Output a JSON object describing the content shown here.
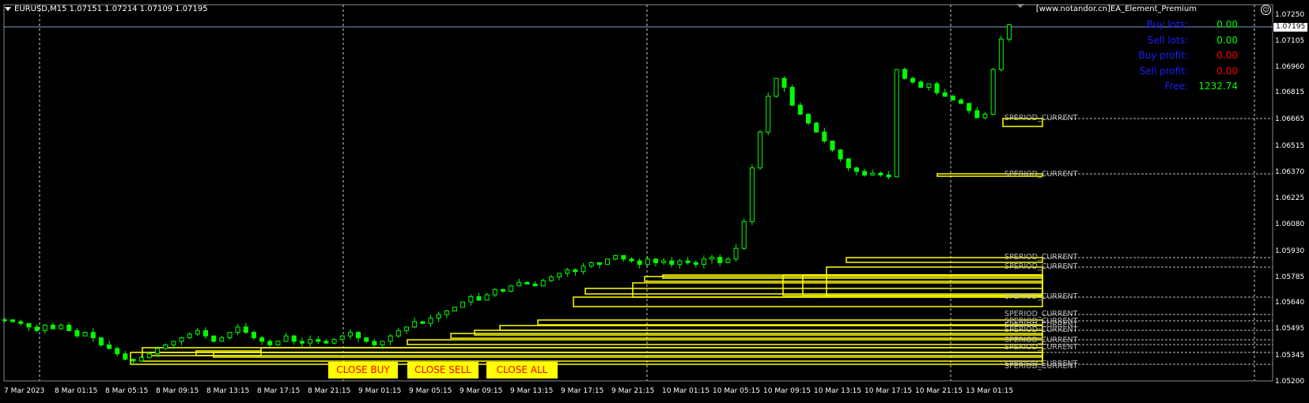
{
  "window": {
    "title": "EURUSD,M15  1.07151 1.07214 1.07109 1.07195",
    "ea_name": "[www.notandor.cn]EA_Element_Premium",
    "smiley": "☺"
  },
  "colors": {
    "background": "#000000",
    "candle": "#00ff00",
    "rectangle": "#ffff00",
    "button_bg": "#ffff00",
    "button_text": "#ff0000",
    "label_blue": "#1e1eff",
    "value_green": "#00ff00",
    "value_red": "#ff0000"
  },
  "panel": [
    {
      "label": "Buy lots:",
      "value": "0.00",
      "color": "green"
    },
    {
      "label": "Sell lots:",
      "value": "0.00",
      "color": "green"
    },
    {
      "label": "Buy profit:",
      "value": "0.00",
      "color": "red"
    },
    {
      "label": "Sell profit:",
      "value": "0.00",
      "color": "red"
    },
    {
      "label": "Free:",
      "value": "1232.74",
      "color": "green"
    }
  ],
  "buttons": {
    "close_buy": "CLOSE BUY",
    "close_sell": "CLOSE SELL",
    "close_all": "CLOSE ALL"
  },
  "price_axis": {
    "current_price": "1.07195",
    "labels": [
      "1.07250",
      "1.07105",
      "1.06960",
      "1.06815",
      "1.06665",
      "1.06515",
      "1.06370",
      "1.06225",
      "1.06080",
      "1.05930",
      "1.05785",
      "1.05640",
      "1.05495",
      "1.05345",
      "1.05200"
    ]
  },
  "time_axis": [
    "7 Mar 2023",
    "8 Mar 01:15",
    "8 Mar 05:15",
    "8 Mar 09:15",
    "8 Mar 13:15",
    "8 Mar 17:15",
    "8 Mar 21:15",
    "9 Mar 01:15",
    "9 Mar 05:15",
    "9 Mar 09:15",
    "9 Mar 13:15",
    "9 Mar 17:15",
    "9 Mar 21:15",
    "10 Mar 01:15",
    "10 Mar 05:15",
    "10 Mar 09:15",
    "10 Mar 13:15",
    "10 Mar 17:15",
    "10 Mar 21:15",
    "13 Mar 01:15"
  ],
  "period_label_text": "SPERIOD_CURRENT",
  "chart_data": {
    "type": "candlestick",
    "symbol": "EURUSD",
    "timeframe": "M15",
    "ylim": [
      1.052,
      1.0725
    ],
    "closes": [
      1.0555,
      1.0554,
      1.0553,
      1.0551,
      1.0549,
      1.0552,
      1.055,
      1.0552,
      1.0549,
      1.0546,
      1.0548,
      1.0545,
      1.0541,
      1.0539,
      1.0536,
      1.0533,
      1.0532,
      1.0534,
      1.0536,
      1.0539,
      1.0541,
      1.0543,
      1.0545,
      1.0547,
      1.0549,
      1.0546,
      1.0543,
      1.0545,
      1.0548,
      1.0551,
      1.0548,
      1.0545,
      1.0543,
      1.0541,
      1.0543,
      1.0546,
      1.0543,
      1.0542,
      1.0544,
      1.0543,
      1.0542,
      1.0544,
      1.0546,
      1.0548,
      1.0545,
      1.0543,
      1.0541,
      1.0543,
      1.0546,
      1.0549,
      1.0551,
      1.0554,
      1.0553,
      1.0556,
      1.0558,
      1.056,
      1.0562,
      1.0565,
      1.0568,
      1.0566,
      1.0569,
      1.0572,
      1.0571,
      1.0574,
      1.0576,
      1.0575,
      1.0574,
      1.0577,
      1.0579,
      1.0581,
      1.0583,
      1.0582,
      1.0585,
      1.0587,
      1.0586,
      1.0589,
      1.0591,
      1.0589,
      1.0588,
      1.0586,
      1.0589,
      1.0587,
      1.0588,
      1.0586,
      1.0588,
      1.0587,
      1.0586,
      1.0589,
      1.059,
      1.0587,
      1.0589,
      1.0595,
      1.061,
      1.064,
      1.066,
      1.068,
      1.069,
      1.0685,
      1.0675,
      1.067,
      1.0665,
      1.066,
      1.0655,
      1.065,
      1.0645,
      1.064,
      1.0638,
      1.0636,
      1.0637,
      1.0636,
      1.0635,
      1.0695,
      1.069,
      1.0688,
      1.0685,
      1.0687,
      1.0682,
      1.068,
      1.0678,
      1.0676,
      1.0672,
      1.0668,
      1.067,
      1.0695,
      1.0712,
      1.072
    ]
  }
}
